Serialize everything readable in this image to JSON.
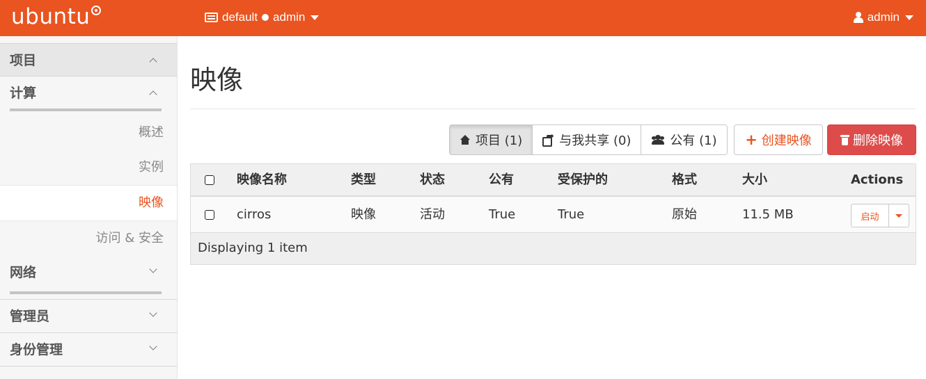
{
  "brand": {
    "name": "ubuntu"
  },
  "header": {
    "project_domain": "default",
    "project_name": "admin",
    "user": "admin"
  },
  "colors": {
    "brand": "#E95420",
    "danger": "#dd4b4b"
  },
  "sidebar": {
    "sections": [
      {
        "label": "项目",
        "state": "expanded"
      },
      {
        "label": "计算",
        "state": "expanded"
      },
      {
        "label": "网络",
        "state": "collapsed"
      },
      {
        "label": "管理员",
        "state": "collapsed"
      },
      {
        "label": "身份管理",
        "state": "collapsed"
      }
    ],
    "compute_items": [
      {
        "label": "概述"
      },
      {
        "label": "实例"
      },
      {
        "label": "映像",
        "active": true
      },
      {
        "label": "访问 & 安全"
      }
    ]
  },
  "page": {
    "title": "映像"
  },
  "filters": [
    {
      "label": "项目 (1)",
      "icon": "home-icon",
      "active": true
    },
    {
      "label": "与我共享 (0)",
      "icon": "share-icon"
    },
    {
      "label": "公有 (1)",
      "icon": "users-icon"
    }
  ],
  "actions": {
    "create": "创建映像",
    "delete": "删除映像"
  },
  "table": {
    "columns": [
      "映像名称",
      "类型",
      "状态",
      "公有",
      "受保护的",
      "格式",
      "大小",
      "Actions"
    ],
    "rows": [
      {
        "name": "cirros",
        "type": "映像",
        "status": "活动",
        "public": "True",
        "protected": "True",
        "format": "原始",
        "size": "11.5 MB",
        "action": "启动"
      }
    ],
    "footer": "Displaying 1 item"
  }
}
